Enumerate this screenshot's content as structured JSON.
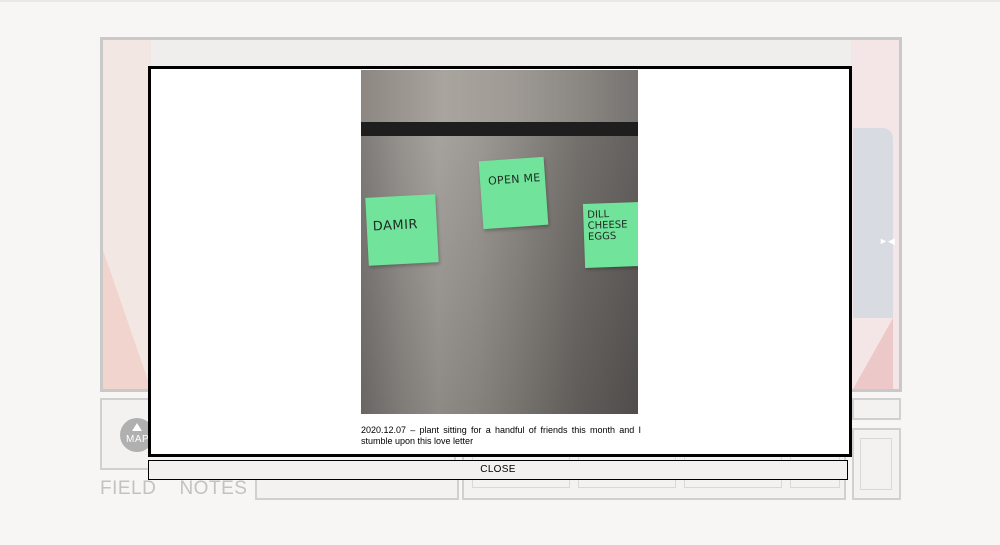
{
  "background": {
    "map_label": "MAP",
    "field_notes": "FIELD    NOTES"
  },
  "icons": {
    "map": "triangle-up-icon",
    "next": "arrow-right-icon"
  },
  "modal": {
    "sticky_notes": {
      "damir": "DAMIR",
      "open_me": "OPEN ME",
      "dill": "DILL",
      "cheese": "CHEESE",
      "eggs": "EGGS"
    },
    "caption": "2020.12.07 – plant sitting for a handful of friends this month and I stumble upon this love letter",
    "close_label": "CLOSE"
  },
  "colors": {
    "sticky_note": "#72e39a",
    "modal_border": "#000000",
    "page_background": "#f7f6f4"
  }
}
